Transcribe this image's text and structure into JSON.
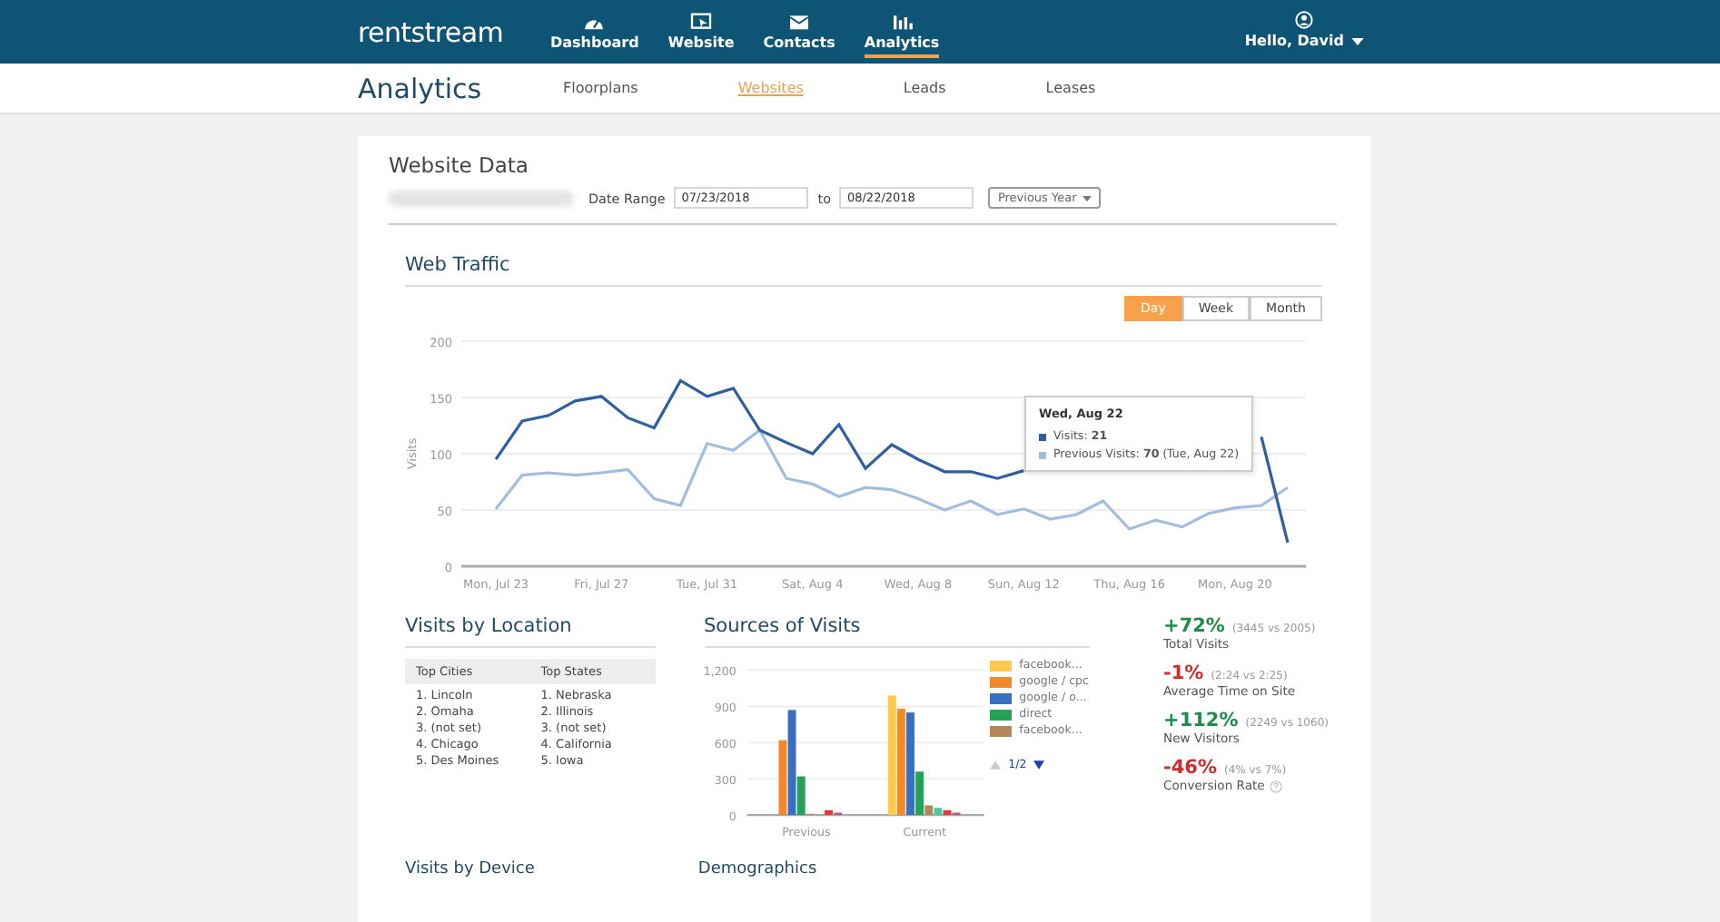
{
  "header": {
    "logo": "rentstream",
    "nav": [
      {
        "label": "Dashboard",
        "selected": false
      },
      {
        "label": "Website",
        "selected": false
      },
      {
        "label": "Contacts",
        "selected": false
      },
      {
        "label": "Analytics",
        "selected": true
      }
    ],
    "user": "Hello, David"
  },
  "subnav": {
    "title": "Analytics",
    "tabs": [
      {
        "label": "Floorplans",
        "selected": false
      },
      {
        "label": "Websites",
        "selected": true
      },
      {
        "label": "Leads",
        "selected": false
      },
      {
        "label": "Leases",
        "selected": false
      }
    ]
  },
  "website_data": {
    "title": "Website Data",
    "date_range_label": "Date Range",
    "from": "07/23/2018",
    "to_label": "to",
    "to": "08/22/2018",
    "compare": "Previous Year"
  },
  "web_traffic": {
    "title": "Web Traffic",
    "periods": [
      {
        "label": "Day",
        "selected": true
      },
      {
        "label": "Week",
        "selected": false
      },
      {
        "label": "Month",
        "selected": false
      }
    ],
    "chart_data": {
      "type": "line",
      "grid": true,
      "ylabel": "Visits",
      "ylim": [
        0,
        200
      ],
      "yticks": [
        0,
        50,
        100,
        150,
        200
      ],
      "categories": [
        "Mon, Jul 23",
        null,
        null,
        null,
        "Fri, Jul 27",
        null,
        null,
        null,
        "Tue, Jul 31",
        null,
        null,
        null,
        "Sat, Aug 4",
        null,
        null,
        null,
        "Wed, Aug 8",
        null,
        null,
        null,
        "Sun, Aug 12",
        null,
        null,
        null,
        "Thu, Aug 16",
        null,
        null,
        null,
        "Mon, Aug 20",
        null,
        null
      ],
      "series": [
        {
          "color": "#2f5f9e",
          "values": [
            95,
            129,
            134,
            147,
            151,
            132,
            123,
            165,
            151,
            158,
            121,
            110,
            100,
            126,
            87,
            108,
            95,
            84,
            84,
            78,
            85,
            null,
            null,
            null,
            null,
            null,
            null,
            null,
            null,
            115,
            21
          ]
        },
        {
          "color": "#a3bde0",
          "values": [
            51,
            81,
            83,
            81,
            83,
            86,
            60,
            54,
            109,
            103,
            121,
            78,
            73,
            62,
            70,
            68,
            60,
            50,
            58,
            46,
            51,
            42,
            46,
            58,
            33,
            41,
            35,
            47,
            52,
            54,
            70
          ]
        }
      ]
    },
    "tooltip": {
      "title": "Wed, Aug 22",
      "lines": [
        {
          "label": "Visits:",
          "value": "21"
        },
        {
          "label": "Previous Visits:",
          "value": "70",
          "note": "(Tue, Aug 22)"
        }
      ]
    }
  },
  "location": {
    "title": "Visits by Location",
    "columns": [
      {
        "heading": "Top Cities",
        "items": [
          "1. Lincoln",
          "2. Omaha",
          "3. (not set)",
          "4. Chicago",
          "5. Des Moines"
        ]
      },
      {
        "heading": "Top States",
        "items": [
          "1. Nebraska",
          "2. Illinois",
          "3. (not set)",
          "4. California",
          "5. Iowa"
        ]
      }
    ]
  },
  "sources": {
    "title": "Sources of Visits",
    "pager": "1/2",
    "chart_data": {
      "type": "bar",
      "grid": true,
      "categories": [
        "Previous",
        "Current"
      ],
      "ylim": [
        0,
        1200
      ],
      "yticks": [
        0,
        300,
        600,
        900,
        {
          "value": 1200,
          "label": "1,200"
        }
      ],
      "series": [
        {
          "name": "facebook...",
          "color": "#ffc94d",
          "values": [
            0,
            990
          ]
        },
        {
          "name": "google / cpc",
          "color": "#f08a2c",
          "values": [
            620,
            880
          ]
        },
        {
          "name": "google / o...",
          "color": "#3a6fc0",
          "values": [
            870,
            850
          ]
        },
        {
          "name": "direct",
          "color": "#27a05a",
          "values": [
            320,
            360
          ]
        },
        {
          "name": "facebook...",
          "color": "#b5865a",
          "values": [
            10,
            80
          ]
        },
        {
          "color": "#4cc9a0",
          "values": [
            0,
            60
          ]
        },
        {
          "color": "#e03a3a",
          "values": [
            40,
            40
          ]
        },
        {
          "color": "#c05a7a",
          "values": [
            20,
            20
          ]
        }
      ]
    }
  },
  "stats": [
    {
      "change": "+72%",
      "color": "#1f8c4d",
      "detail": "(3445 vs 2005)",
      "label": "Total Visits",
      "help": false
    },
    {
      "change": "-1%",
      "color": "#c9302c",
      "detail": "(2:24 vs 2:25)",
      "label": "Average Time on Site",
      "help": false
    },
    {
      "change": "+112%",
      "color": "#1f8c4d",
      "detail": "(2249 vs 1060)",
      "label": "New Visitors",
      "help": false
    },
    {
      "change": "-46%",
      "color": "#c9302c",
      "detail": "(4% vs 7%)",
      "label": "Conversion Rate",
      "help": true
    }
  ],
  "bottom_sections": [
    "Visits by Device",
    "Demographics"
  ]
}
